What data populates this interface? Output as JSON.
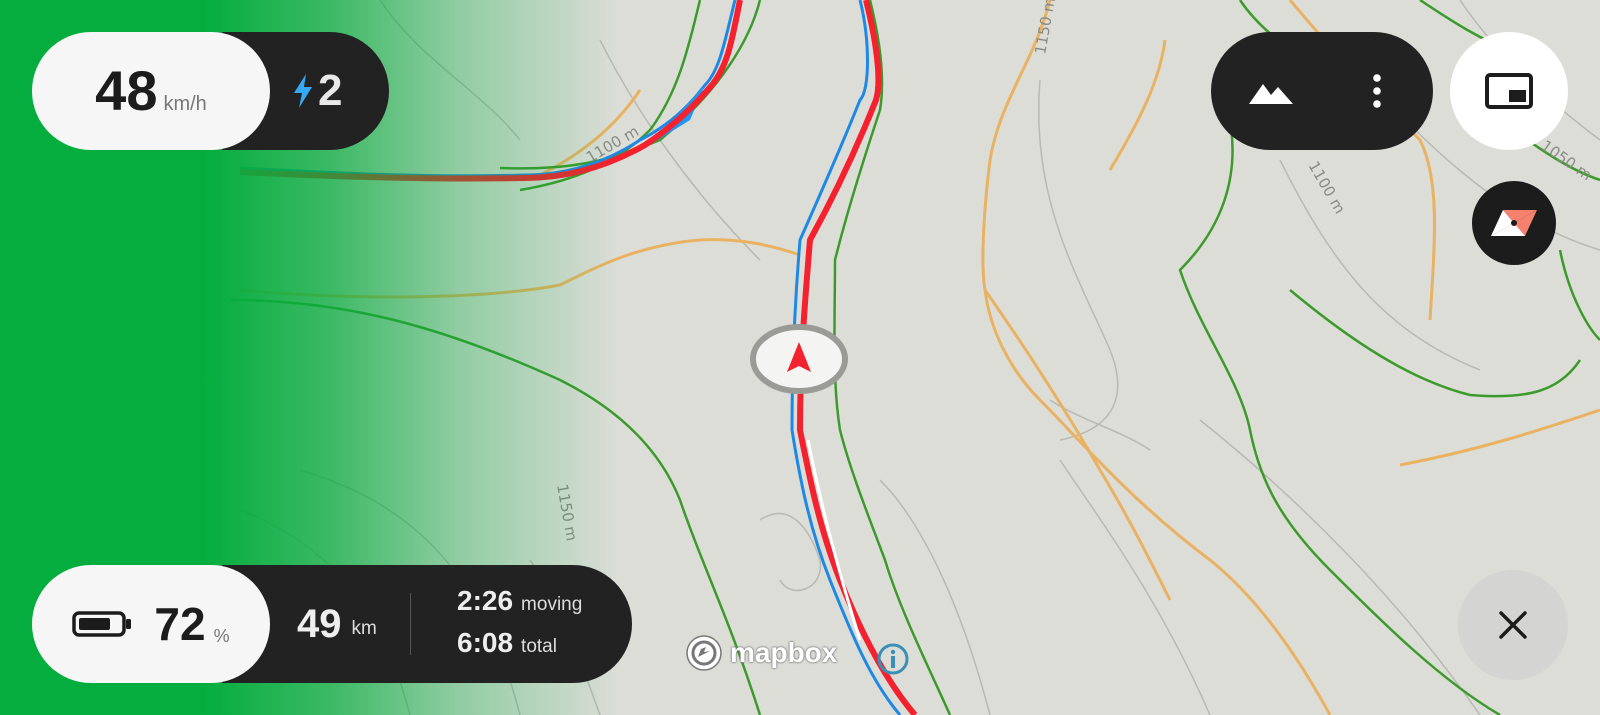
{
  "speed": {
    "value": "48",
    "unit": "km/h"
  },
  "assist": {
    "level": "2",
    "icon": "lightning-bolt-icon",
    "icon_color": "#36a9f5"
  },
  "battery": {
    "value": "72",
    "unit": "%",
    "icon": "battery-icon"
  },
  "trip": {
    "distance_value": "49",
    "distance_unit": "km",
    "moving_time": "2:26",
    "moving_label": "moving",
    "total_time": "6:08",
    "total_label": "total"
  },
  "toolbar": {
    "terrain_icon": "mountain-icon",
    "more_icon": "more-vert-icon"
  },
  "controls": {
    "pip_icon": "picture-in-picture-icon",
    "compass_icon": "compass-icon",
    "close_icon": "close-icon"
  },
  "map": {
    "contour_labels": [
      "1150 m",
      "1100 m",
      "1050 m",
      "1100 m",
      "1150 m"
    ],
    "attribution": "mapbox",
    "info_icon": "info-icon",
    "route_color": "#f4212e",
    "track_color": "#1e88e5",
    "accent_green": "#05ad3e"
  }
}
